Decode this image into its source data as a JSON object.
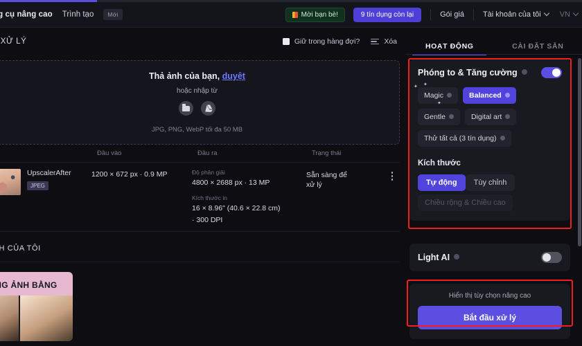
{
  "header": {
    "nav_advanced": "ng cụ nâng cao",
    "nav_creator": "Trình tạo",
    "badge_new": "Mới",
    "invite_label": "Mời bạn bè!",
    "credits_label": "9 tín dụng còn lại",
    "pricing_label": "Gói giá",
    "account_label": "Tài khoản của tôi",
    "language_label": "VN"
  },
  "toolbar": {
    "title": "N XỬ LÝ",
    "keep_queue_label": "Giữ trong hàng đợi?",
    "clear_label": "Xóa"
  },
  "tabs": [
    {
      "label": "HOẠT ĐỘNG",
      "active": true
    },
    {
      "label": "CÀI ĐẶT SẴN",
      "active": false
    }
  ],
  "dropzone": {
    "title_main": "Thả ảnh của bạn,",
    "title_link": "duyệt",
    "or_import": "hoặc nhập từ",
    "formats": "JPG, PNG, WebP tối đa 50 MB"
  },
  "table": {
    "columns": [
      "",
      "Đầu vào",
      "Đầu ra",
      "Trạng thái"
    ],
    "rows": [
      {
        "filename": "UpscalerAfter",
        "filetype": "JPEG",
        "input": "1200 × 672 px · 0.9 MP",
        "output_res_label": "Độ phân giải",
        "output_res_value": "4800 × 2688 px · 13 MP",
        "print_size_label": "Kích thước in",
        "print_size_value": "16 × 8.96\" (40.6 × 22.8 cm)",
        "print_dpi": "· 300 DPI",
        "status": "Sẵn sàng để xử lý"
      }
    ]
  },
  "my_images": {
    "title": "NH CỦA TÔI",
    "promo_text": "ƯỢNG ẢNH BẰNG"
  },
  "settings": {
    "upscale": {
      "title": "Phóng to & Tăng cường",
      "enabled": true,
      "modes": [
        {
          "label": "Magic",
          "active": false
        },
        {
          "label": "Balanced",
          "active": true
        },
        {
          "label": "Gentle",
          "active": false
        },
        {
          "label": "Digital art",
          "active": false
        },
        {
          "label": "Thử tất cả (3 tín dụng)",
          "active": false
        }
      ]
    },
    "size": {
      "title": "Kích thước",
      "options": [
        {
          "label": "Tự động",
          "active": true
        },
        {
          "label": "Tùy chỉnh",
          "active": false
        }
      ],
      "dimension_placeholder": "Chiều rộng & Chiều cao"
    },
    "light_ai": {
      "title": "Light AI",
      "enabled": false
    },
    "advanced_link": "Hiển thị tùy chọn nâng cao",
    "start_button": "Bắt đầu xử lý"
  },
  "colors": {
    "accent": "#5b4ee0",
    "highlight_outline": "#f01e1e",
    "link": "#6c7bff"
  }
}
